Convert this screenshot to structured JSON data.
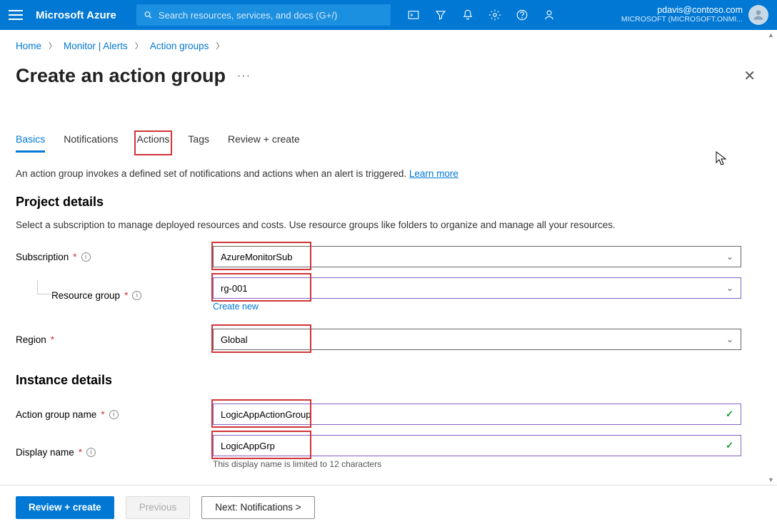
{
  "topbar": {
    "brand": "Microsoft Azure",
    "search_placeholder": "Search resources, services, and docs (G+/)",
    "user_email": "pdavis@contoso.com",
    "user_org": "MICROSOFT (MICROSOFT.ONMI..."
  },
  "breadcrumb": {
    "items": [
      "Home",
      "Monitor | Alerts",
      "Action groups"
    ]
  },
  "page": {
    "title": "Create an action group"
  },
  "tabs": {
    "items": [
      {
        "label": "Basics",
        "active": true
      },
      {
        "label": "Notifications"
      },
      {
        "label": "Actions",
        "highlight": true
      },
      {
        "label": "Tags"
      },
      {
        "label": "Review + create"
      }
    ]
  },
  "desc": {
    "text_prefix": "An action group invokes a defined set of notifications and actions when an alert is triggered. ",
    "learn_more": "Learn more"
  },
  "project_details": {
    "heading": "Project details",
    "sub": "Select a subscription to manage deployed resources and costs. Use resource groups like folders to organize and manage all your resources.",
    "subscription": {
      "label": "Subscription",
      "value": "AzureMonitorSub"
    },
    "resource_group": {
      "label": "Resource group",
      "value": "rg-001",
      "create_new": "Create new"
    },
    "region": {
      "label": "Region",
      "value": "Global"
    }
  },
  "instance_details": {
    "heading": "Instance details",
    "action_group_name": {
      "label": "Action group name",
      "value": "LogicAppActionGroup"
    },
    "display_name": {
      "label": "Display name",
      "value": "LogicAppGrp",
      "hint": "This display name is limited to 12 characters"
    }
  },
  "footer": {
    "review": "Review + create",
    "previous": "Previous",
    "next": "Next: Notifications >"
  }
}
